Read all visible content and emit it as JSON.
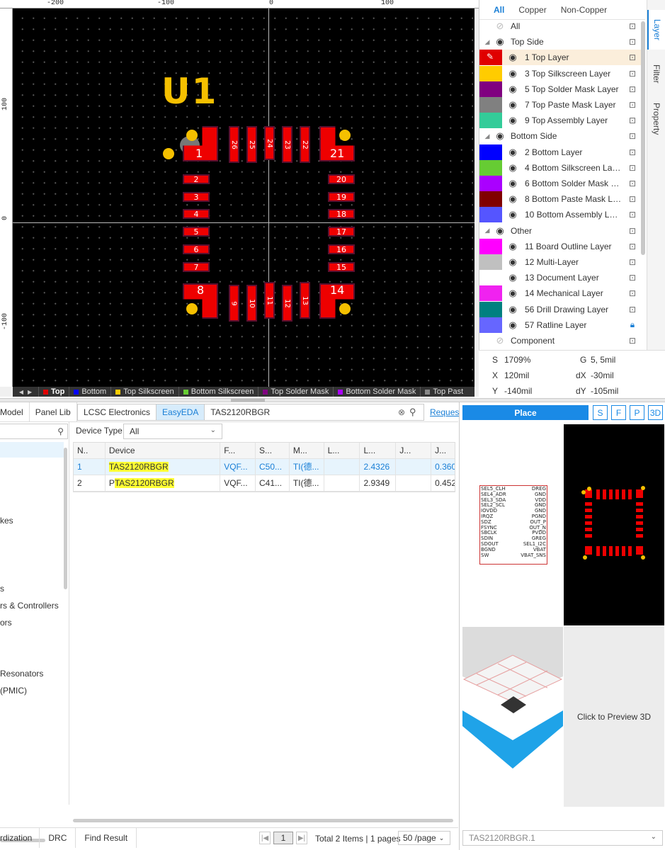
{
  "ruler": {
    "top_labels": [
      "-200",
      "-100",
      "0",
      "100"
    ],
    "left_labels": [
      "100",
      "0",
      "-100"
    ]
  },
  "canvas": {
    "designator": "U1",
    "pads_left": [
      "2",
      "3",
      "4",
      "5",
      "6",
      "7"
    ],
    "pads_right": [
      "20",
      "19",
      "18",
      "17",
      "16",
      "15"
    ],
    "pads_top": [
      "26",
      "25",
      "24",
      "23",
      "22"
    ],
    "pads_bottom": [
      "9",
      "10",
      "11",
      "12",
      "13"
    ],
    "corner_pads": [
      "1",
      "21",
      "8",
      "14"
    ]
  },
  "layer_tabs": [
    {
      "label": "Top",
      "color": "#e00000"
    },
    {
      "label": "Bottom",
      "color": "#0000ff"
    },
    {
      "label": "Top Silkscreen",
      "color": "#ffcc00"
    },
    {
      "label": "Bottom Silkscreen",
      "color": "#66cc33"
    },
    {
      "label": "Top Solder Mask",
      "color": "#800080"
    },
    {
      "label": "Bottom Solder Mask",
      "color": "#aa00ff"
    },
    {
      "label": "Top Past",
      "color": "#888888"
    }
  ],
  "layer_panel": {
    "tabs": [
      "All",
      "Copper",
      "Non-Copper"
    ],
    "rows": [
      {
        "type": "group",
        "label": "All"
      },
      {
        "type": "group",
        "label": "Top Side"
      },
      {
        "type": "layer",
        "label": "1 Top Layer",
        "color": "#e00000",
        "selected": true
      },
      {
        "type": "layer",
        "label": "3 Top Silkscreen Layer",
        "color": "#ffcc00"
      },
      {
        "type": "layer",
        "label": "5 Top Solder Mask Layer",
        "color": "#800080"
      },
      {
        "type": "layer",
        "label": "7 Top Paste Mask Layer",
        "color": "#808080"
      },
      {
        "type": "layer",
        "label": "9 Top Assembly Layer",
        "color": "#33cc99"
      },
      {
        "type": "group",
        "label": "Bottom Side"
      },
      {
        "type": "layer",
        "label": "2 Bottom Layer",
        "color": "#0000ff"
      },
      {
        "type": "layer",
        "label": "4 Bottom Silkscreen Layer",
        "color": "#66cc33"
      },
      {
        "type": "layer",
        "label": "6 Bottom Solder Mask L...",
        "color": "#aa00ff"
      },
      {
        "type": "layer",
        "label": "8 Bottom Paste Mask La...",
        "color": "#800000"
      },
      {
        "type": "layer",
        "label": "10 Bottom Assembly Layer",
        "color": "#5555ff"
      },
      {
        "type": "group",
        "label": "Other"
      },
      {
        "type": "layer",
        "label": "11 Board Outline Layer",
        "color": "#ff00ff"
      },
      {
        "type": "layer",
        "label": "12 Multi-Layer",
        "color": "#c0c0c0"
      },
      {
        "type": "layer",
        "label": "13 Document Layer",
        "color": "#ffffff"
      },
      {
        "type": "layer",
        "label": "14 Mechanical Layer",
        "color": "#f022f0"
      },
      {
        "type": "layer",
        "label": "56 Drill Drawing Layer",
        "color": "#008080"
      },
      {
        "type": "layer",
        "label": "57 Ratline Layer",
        "color": "#6666ff"
      },
      {
        "type": "group",
        "label": "Component"
      }
    ]
  },
  "side_tabs": [
    "Layer",
    "Filter",
    "Property"
  ],
  "coords": {
    "s": "S",
    "s_val": "1709%",
    "g": "G",
    "g_val": "5, 5mil",
    "x": "X",
    "x_val": "120mil",
    "dx": "dX",
    "dx_val": "-30mil",
    "y": "Y",
    "y_val": "-140mil",
    "dy": "dY",
    "dy_val": "-105mil"
  },
  "lib": {
    "tabs": [
      "Model",
      "Panel Lib",
      "LCSC Electronics",
      "EasyEDA"
    ],
    "search_value": "TAS2120RBGR",
    "request_link": "Reques",
    "device_type_label": "Device Type",
    "device_type_value": "All",
    "tree_items": [
      "kes",
      "s",
      "rs & Controllers",
      "ors",
      "Resonators",
      "(PMIC)"
    ],
    "columns": [
      "N..",
      "Device",
      "F...",
      "S...",
      "M...",
      "L...",
      "L...",
      "J...",
      "J..."
    ],
    "rows": [
      {
        "n": "1",
        "device_pre": "",
        "device_hl": "TAS2120RBGR",
        "f": "VQF...",
        "s": "C50...",
        "m": "TI(德...",
        "l1": "",
        "l2": "2.4326",
        "j1": "",
        "j2": "0.360"
      },
      {
        "n": "2",
        "device_pre": "P",
        "device_hl": "TAS2120RBGR",
        "f": "VQF...",
        "s": "C41...",
        "m": "TI(德...",
        "l1": "",
        "l2": "2.9349",
        "j1": "",
        "j2": "0.452"
      }
    ],
    "bottom_tabs": [
      "rdization",
      "DRC",
      "Find Result"
    ],
    "page_current": "1",
    "pager_text": "Total 2 Items | 1 pages",
    "per_page": "50 /page"
  },
  "preview": {
    "place": "Place",
    "buttons": [
      "S",
      "F",
      "P",
      "3D"
    ],
    "sym_left": [
      "SEL5_CLH",
      "SEL4_ADR",
      "SEL3_SDA",
      "SEL2_SCL",
      "IOVDD",
      "IRQZ",
      "SDZ",
      "FSYNC",
      "SBCLK",
      "SDIN",
      "SDOUT",
      "BGND",
      "SW"
    ],
    "sym_right": [
      "DREG",
      "GND",
      "VDD",
      "GND",
      "GND",
      "PGND",
      "OUT_P",
      "OUT_N",
      "PVDD",
      "GREG",
      "SEL1_I2C",
      "VBAT",
      "VBAT_SNS"
    ],
    "click_3d": "Click to Preview 3D",
    "footer_value": "TAS2120RBGR.1"
  }
}
